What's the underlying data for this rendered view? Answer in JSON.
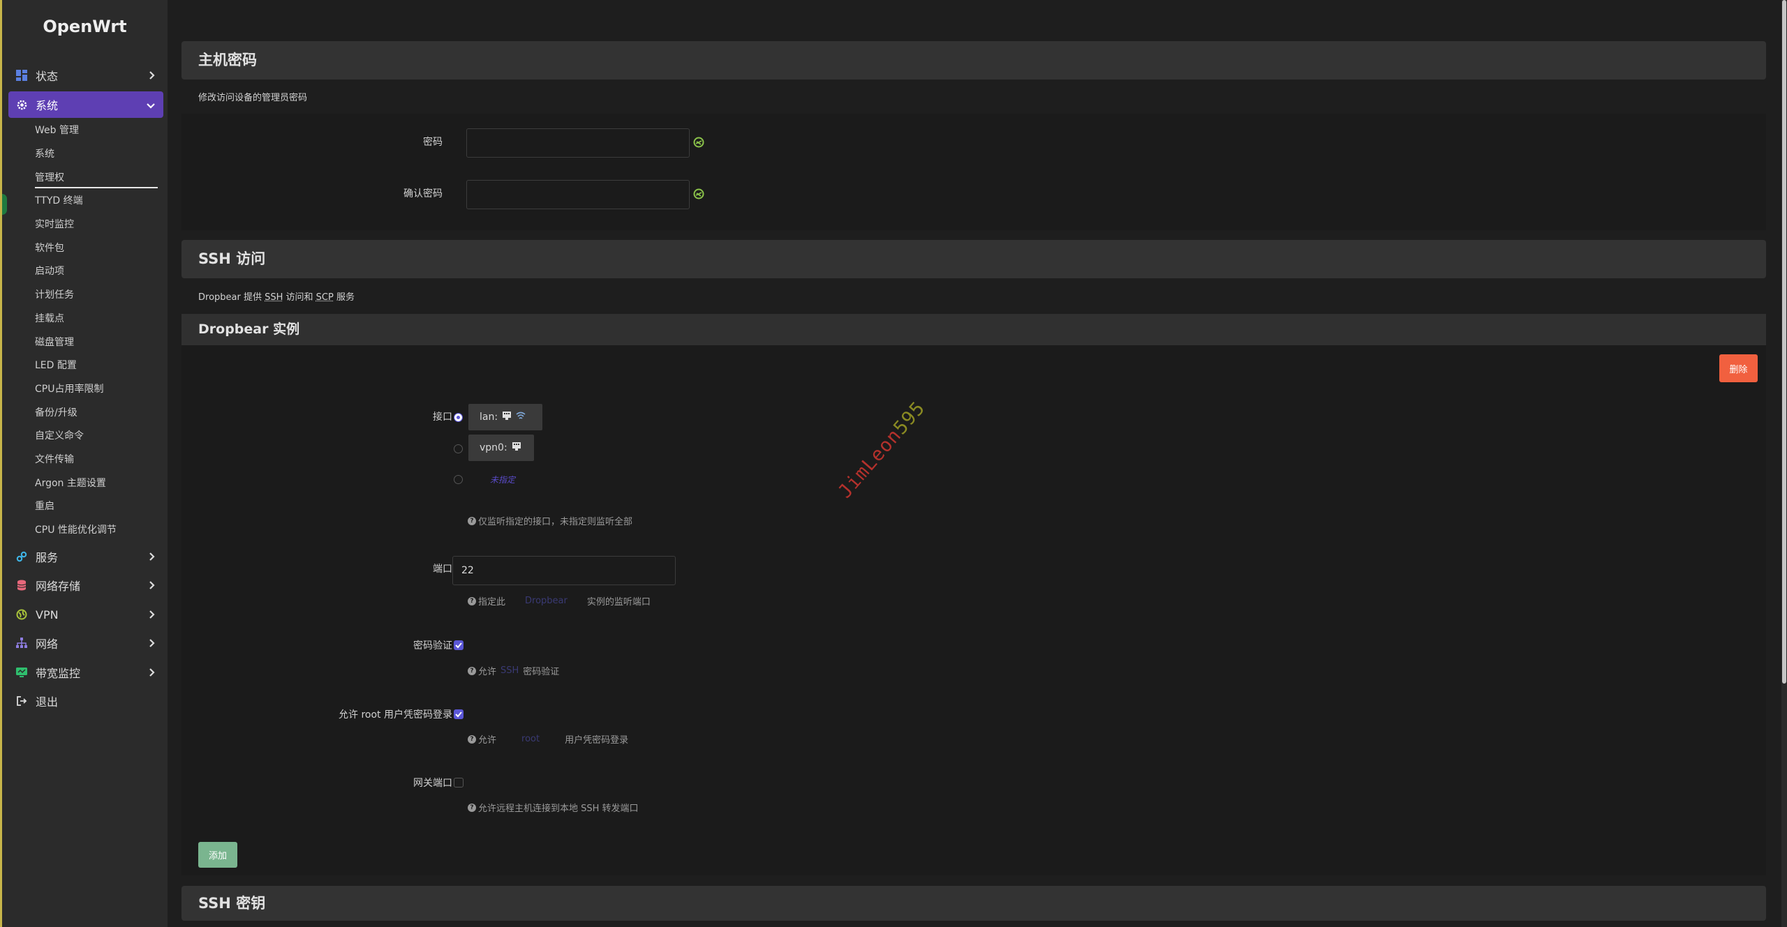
{
  "app": {
    "logo": "OpenWrt"
  },
  "sidebar": {
    "top_items": [
      {
        "label": "状态",
        "icon": "dashboard-icon"
      },
      {
        "label": "系统",
        "icon": "gear-icon"
      }
    ],
    "sub_items": [
      "Web 管理",
      "系统",
      "管理权",
      "TTYD 终端",
      "实时监控",
      "软件包",
      "启动项",
      "计划任务",
      "挂载点",
      "磁盘管理",
      "LED 配置",
      "CPU占用率限制",
      "备份/升级",
      "自定义命令",
      "文件传输",
      "Argon 主题设置",
      "重启",
      "CPU 性能优化调节"
    ],
    "bottom_items": [
      {
        "label": "服务",
        "icon": "link-icon"
      },
      {
        "label": "网络存储",
        "icon": "database-icon"
      },
      {
        "label": "VPN",
        "icon": "globe-icon"
      },
      {
        "label": "网络",
        "icon": "network-icon"
      },
      {
        "label": "带宽监控",
        "icon": "monitor-icon"
      },
      {
        "label": "退出",
        "icon": "logout-icon"
      }
    ],
    "accent": "#5e3fb3"
  },
  "password_section": {
    "title": "主机密码",
    "description": "修改访问设备的管理员密码",
    "password_label": "密码",
    "password_value": "",
    "confirm_label": "确认密码",
    "confirm_value": ""
  },
  "ssh_section": {
    "title": "SSH 访问",
    "desc_prefix": "Dropbear 提供 ",
    "desc_ssh": "SSH",
    "desc_mid": " 访问和 ",
    "desc_scp": "SCP",
    "desc_suffix": " 服务"
  },
  "dropbear": {
    "title": "Dropbear 实例",
    "delete_label": "删除",
    "interface_label": "接口",
    "interfaces": [
      {
        "name": "lan:",
        "checked": true
      },
      {
        "name": "vpn0:",
        "checked": false
      }
    ],
    "unspecified_label": "未指定",
    "interface_help": "仅监听指定的接口，未指定则监听全部",
    "port_label": "端口",
    "port_value": "22",
    "port_help_a": "指定此",
    "port_help_b": "Dropbear",
    "port_help_c": "实例的监听端口",
    "pwauth_label": "密码验证",
    "pwauth_checked": true,
    "pwauth_help_a": "允许",
    "pwauth_help_b": "SSH",
    "pwauth_help_c": "密码验证",
    "root_label": "允许 root 用户凭密码登录",
    "root_checked": true,
    "root_help_a": "允许",
    "root_help_b": "root",
    "root_help_c": "用户凭密码登录",
    "gateway_label": "网关端口",
    "gateway_checked": false,
    "gateway_help": "允许远程主机连接到本地 SSH 转发端口",
    "add_label": "添加"
  },
  "ssh_keys": {
    "title": "SSH 密钥"
  },
  "watermark": {
    "part1": "JimLeon",
    "part2": "595"
  },
  "colors": {
    "delete": "#f1603f",
    "add": "#7ab58f",
    "checkbox": "#5b57d6",
    "reveal_icon": "#8bc34a"
  }
}
